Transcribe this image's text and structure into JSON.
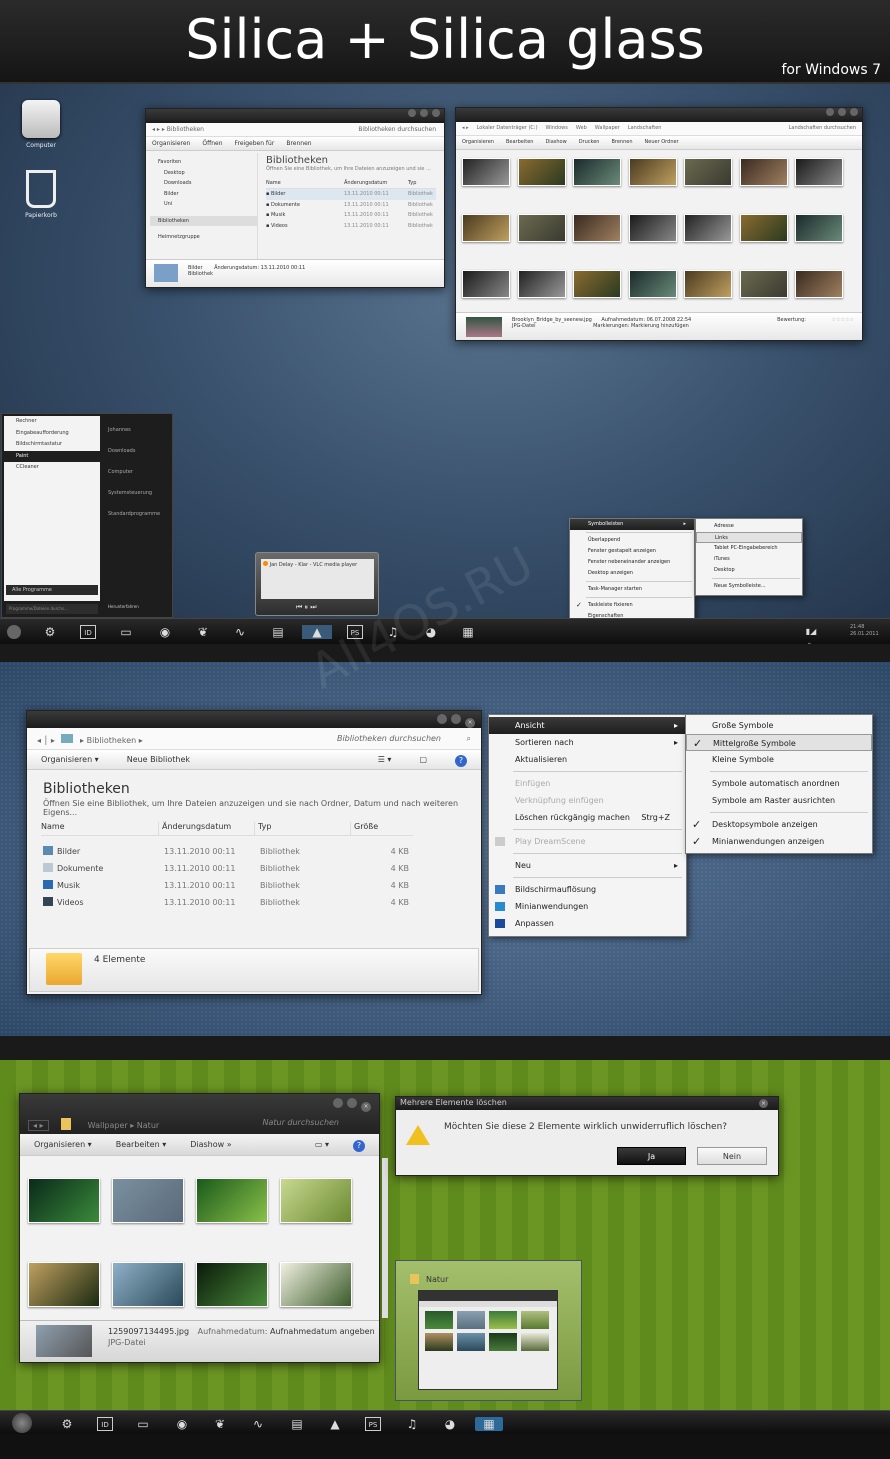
{
  "header": {
    "title": "Silica + Silica glass",
    "subtitle": "for Windows 7"
  },
  "desktop_icons": [
    {
      "label": "Computer"
    },
    {
      "label": "Papierkorb"
    }
  ],
  "explorer_small": {
    "breadcrumb": [
      "Bibliotheken"
    ],
    "search": "Bibliotheken durchsuchen",
    "toolbar": [
      "Organisieren",
      "Öffnen",
      "Freigeben für",
      "Brennen"
    ],
    "nav": [
      "Favoriten",
      "Desktop",
      "Downloads",
      "Bilder",
      "Uni",
      "Bibliotheken",
      "Heimnetzgruppe"
    ],
    "heading": "Bibliotheken",
    "desc": "Öffnen Sie eine Bibliothek, um Ihre Dateien anzuzeigen und sie ...",
    "columns": [
      "Name",
      "Änderungsdatum",
      "Typ"
    ],
    "rows": [
      {
        "name": "Bilder",
        "date": "13.11.2010 00:11",
        "type": "Bibliothek"
      },
      {
        "name": "Dokumente",
        "date": "13.11.2010 00:11",
        "type": "Bibliothek"
      },
      {
        "name": "Musik",
        "date": "13.11.2010 00:11",
        "type": "Bibliothek"
      },
      {
        "name": "Videos",
        "date": "13.11.2010 00:11",
        "type": "Bibliothek"
      }
    ],
    "details": {
      "name": "Bilder",
      "meta": "Änderungsdatum: 13.11.2010 00:11",
      "kind": "Bibliothek"
    }
  },
  "explorer_photos": {
    "breadcrumb": [
      "Lokaler Datenträger (C:)",
      "Windows",
      "Web",
      "Wallpaper",
      "Landschaften"
    ],
    "search": "Landschaften durchsuchen",
    "toolbar": [
      "Organisieren",
      "Bearbeiten",
      "Diashow",
      "Drucken",
      "Brennen",
      "Neuer Ordner"
    ],
    "details": {
      "name": "Brooklyn_Bridge_by_seenew.jpg",
      "date": "Aufnahmedatum: 06.07.2008 22:54",
      "kind": "JPG-Datei",
      "tags": "Markierungen: Markierung hinzufügen",
      "rating": "Bewertung:"
    }
  },
  "startmenu": {
    "programs": [
      "Rechner",
      "Eingabeaufforderung",
      "Bildschirmtastatur",
      "Paint",
      "CCleaner"
    ],
    "all_programs": "Alle Programme",
    "search": "Programme/Dateien durchs...",
    "shutdown": "Herunterfahren",
    "right": [
      "Johannes",
      "Downloads",
      "Computer",
      "Systemsteuerung",
      "Standardprogramme"
    ]
  },
  "vlc": {
    "title": "Jan Delay - Klar - VLC media player"
  },
  "taskbar_menu1": {
    "items": [
      "Symbolleisten",
      "Überlappend",
      "Fenster gestapelt anzeigen",
      "Fenster nebeneinander anzeigen",
      "Desktop anzeigen",
      "Task-Manager starten",
      "Taskleiste fixieren",
      "Eigenschaften"
    ],
    "sub": [
      "Adresse",
      "Links",
      "Tablet PC-Eingabebereich",
      "iTunes",
      "Desktop",
      "Neue Symbolleiste..."
    ]
  },
  "clock": {
    "time": "21:48",
    "date": "26.01.2011"
  },
  "explorer_big": {
    "breadcrumb": "Bibliotheken",
    "search": "Bibliotheken durchsuchen",
    "toolbar": [
      "Organisieren",
      "Neue Bibliothek"
    ],
    "heading": "Bibliotheken",
    "desc": "Öffnen Sie eine Bibliothek, um Ihre Dateien anzuzeigen und sie nach Ordner, Datum und nach weiteren Eigens...",
    "columns": [
      "Name",
      "Änderungsdatum",
      "Typ",
      "Größe"
    ],
    "rows": [
      {
        "name": "Bilder",
        "date": "13.11.2010 00:11",
        "type": "Bibliothek",
        "size": "4 KB"
      },
      {
        "name": "Dokumente",
        "date": "13.11.2010 00:11",
        "type": "Bibliothek",
        "size": "4 KB"
      },
      {
        "name": "Musik",
        "date": "13.11.2010 00:11",
        "type": "Bibliothek",
        "size": "4 KB"
      },
      {
        "name": "Videos",
        "date": "13.11.2010 00:11",
        "type": "Bibliothek",
        "size": "4 KB"
      }
    ],
    "status": "4 Elemente"
  },
  "desktop_menu": {
    "items": [
      "Ansicht",
      "Sortieren nach",
      "Aktualisieren",
      "Einfügen",
      "Verknüpfung einfügen",
      "Löschen rückgängig machen",
      "Play DreamScene",
      "Neu",
      "Bildschirmauflösung",
      "Minianwendungen",
      "Anpassen"
    ],
    "shortcut": "Strg+Z",
    "sub": [
      "Große Symbole",
      "Mittelgroße Symbole",
      "Kleine Symbole",
      "Symbole automatisch anordnen",
      "Symbole am Raster ausrichten",
      "Desktopsymbole anzeigen",
      "Minianwendungen anzeigen"
    ]
  },
  "explorer_green": {
    "breadcrumb": [
      "Wallpaper",
      "Natur"
    ],
    "search": "Natur durchsuchen",
    "toolbar": [
      "Organisieren",
      "Bearbeiten",
      "Diashow"
    ],
    "details": {
      "name": "1259097134495.jpg",
      "date_label": "Aufnahmedatum:",
      "date_value": "Aufnahmedatum angeben",
      "kind": "JPG-Datei"
    }
  },
  "dialog": {
    "title": "Mehrere Elemente löschen",
    "message": "Möchten Sie diese 2 Elemente wirklich unwiderruflich löschen?",
    "yes": "Ja",
    "no": "Nein"
  },
  "thumbnail_preview": {
    "title": "Natur"
  },
  "watermark": "AII4OS.RU"
}
